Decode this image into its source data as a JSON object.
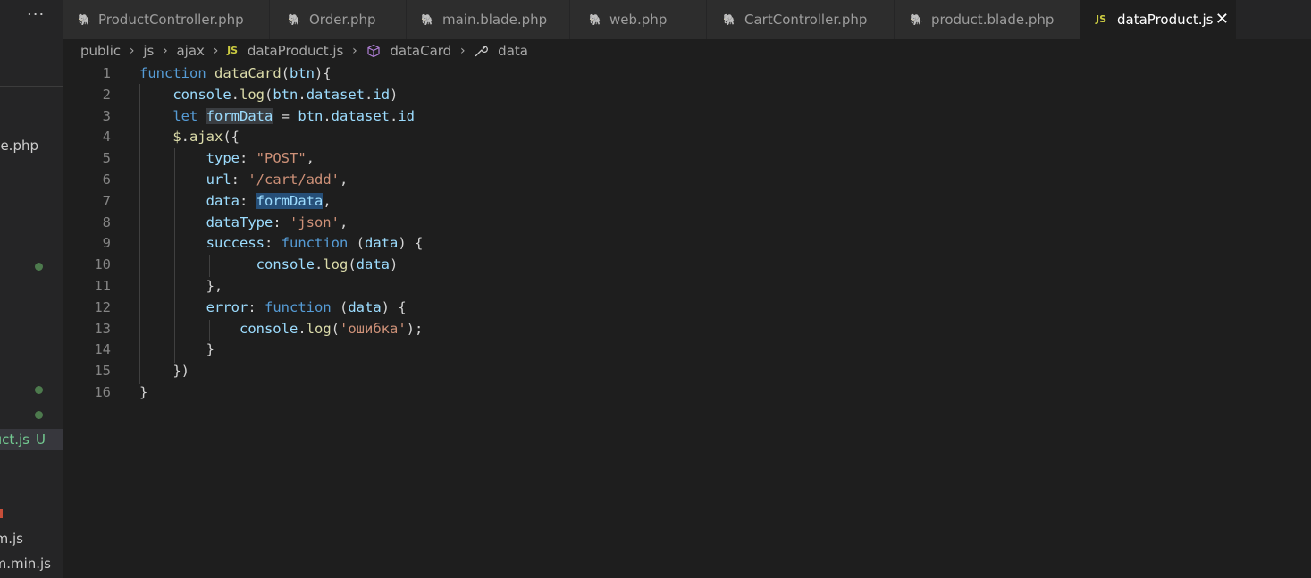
{
  "sidebar": {
    "more_label": "···",
    "rows": [
      {
        "text": "ge.php"
      },
      {
        "text": "uct.js",
        "badge": "U"
      },
      {
        "text": "m.js"
      },
      {
        "text": "m.min.js"
      }
    ]
  },
  "tabs": [
    {
      "label": "ProductController.php",
      "icon": "php-elephant-icon"
    },
    {
      "label": "Order.php",
      "icon": "php-elephant-icon"
    },
    {
      "label": "main.blade.php",
      "icon": "php-elephant-icon"
    },
    {
      "label": "web.php",
      "icon": "php-elephant-icon"
    },
    {
      "label": "CartController.php",
      "icon": "php-elephant-icon"
    },
    {
      "label": "product.blade.php",
      "icon": "php-elephant-icon"
    },
    {
      "label": "dataProduct.js",
      "icon": "js-icon",
      "active": true
    }
  ],
  "js_icon_text": "JS",
  "close_glyph": "✕",
  "breadcrumb": {
    "items": [
      "public",
      "js",
      "ajax",
      "dataProduct.js",
      "dataCard",
      "data"
    ]
  },
  "editor": {
    "line_numbers": [
      "1",
      "2",
      "3",
      "4",
      "5",
      "6",
      "7",
      "8",
      "9",
      "10",
      "11",
      "12",
      "13",
      "14",
      "15",
      "16"
    ],
    "lines": [
      [
        [
          "kw",
          "function "
        ],
        [
          "fn",
          "dataCard"
        ],
        [
          "pl",
          "("
        ],
        [
          "va",
          "btn"
        ],
        [
          "pl",
          "){"
        ]
      ],
      [
        [
          "pl",
          "    "
        ],
        [
          "va",
          "console"
        ],
        [
          "pl",
          "."
        ],
        [
          "fn",
          "log"
        ],
        [
          "pl",
          "("
        ],
        [
          "va",
          "btn"
        ],
        [
          "pl",
          "."
        ],
        [
          "va",
          "dataset"
        ],
        [
          "pl",
          "."
        ],
        [
          "va",
          "id"
        ],
        [
          "pl",
          ")"
        ]
      ],
      [
        [
          "pl",
          "    "
        ],
        [
          "kw",
          "let "
        ],
        [
          "va",
          "formData",
          "hl2"
        ],
        [
          "pl",
          " = "
        ],
        [
          "va",
          "btn"
        ],
        [
          "pl",
          "."
        ],
        [
          "va",
          "dataset"
        ],
        [
          "pl",
          "."
        ],
        [
          "va",
          "id"
        ]
      ],
      [
        [
          "pl",
          "    "
        ],
        [
          "fn",
          "$"
        ],
        [
          "pl",
          "."
        ],
        [
          "fn",
          "ajax"
        ],
        [
          "pl",
          "({"
        ]
      ],
      [
        [
          "pl",
          "        "
        ],
        [
          "va",
          "type"
        ],
        [
          "pl",
          ": "
        ],
        [
          "st",
          "\"POST\""
        ],
        [
          "pl",
          ","
        ]
      ],
      [
        [
          "pl",
          "        "
        ],
        [
          "va",
          "url"
        ],
        [
          "pl",
          ": "
        ],
        [
          "st",
          "'/cart/add'"
        ],
        [
          "pl",
          ","
        ]
      ],
      [
        [
          "pl",
          "        "
        ],
        [
          "va",
          "data"
        ],
        [
          "pl",
          ": "
        ],
        [
          "va",
          "formData",
          "hl"
        ],
        [
          "pl",
          ","
        ]
      ],
      [
        [
          "pl",
          "        "
        ],
        [
          "va",
          "dataType"
        ],
        [
          "pl",
          ": "
        ],
        [
          "st",
          "'json'"
        ],
        [
          "pl",
          ","
        ]
      ],
      [
        [
          "pl",
          "        "
        ],
        [
          "va",
          "success"
        ],
        [
          "pl",
          ": "
        ],
        [
          "kw",
          "function "
        ],
        [
          "pl",
          "("
        ],
        [
          "va",
          "data"
        ],
        [
          "pl",
          ") {"
        ]
      ],
      [
        [
          "pl",
          "              "
        ],
        [
          "va",
          "console"
        ],
        [
          "pl",
          "."
        ],
        [
          "fn",
          "log"
        ],
        [
          "pl",
          "("
        ],
        [
          "va",
          "data"
        ],
        [
          "pl",
          ")"
        ]
      ],
      [
        [
          "pl",
          "        "
        ],
        [
          "pl",
          "},"
        ]
      ],
      [
        [
          "pl",
          "        "
        ],
        [
          "va",
          "error"
        ],
        [
          "pl",
          ": "
        ],
        [
          "kw",
          "function "
        ],
        [
          "pl",
          "("
        ],
        [
          "va",
          "data"
        ],
        [
          "pl",
          ") {"
        ]
      ],
      [
        [
          "pl",
          "            "
        ],
        [
          "va",
          "console"
        ],
        [
          "pl",
          "."
        ],
        [
          "fn",
          "log"
        ],
        [
          "pl",
          "("
        ],
        [
          "st",
          "'ошибка'"
        ],
        [
          "pl",
          ");"
        ]
      ],
      [
        [
          "pl",
          "        "
        ],
        [
          "pl",
          "}"
        ]
      ],
      [
        [
          "pl",
          "    "
        ],
        [
          "pl",
          "})"
        ]
      ],
      [
        [
          "pl",
          "}"
        ]
      ]
    ]
  }
}
